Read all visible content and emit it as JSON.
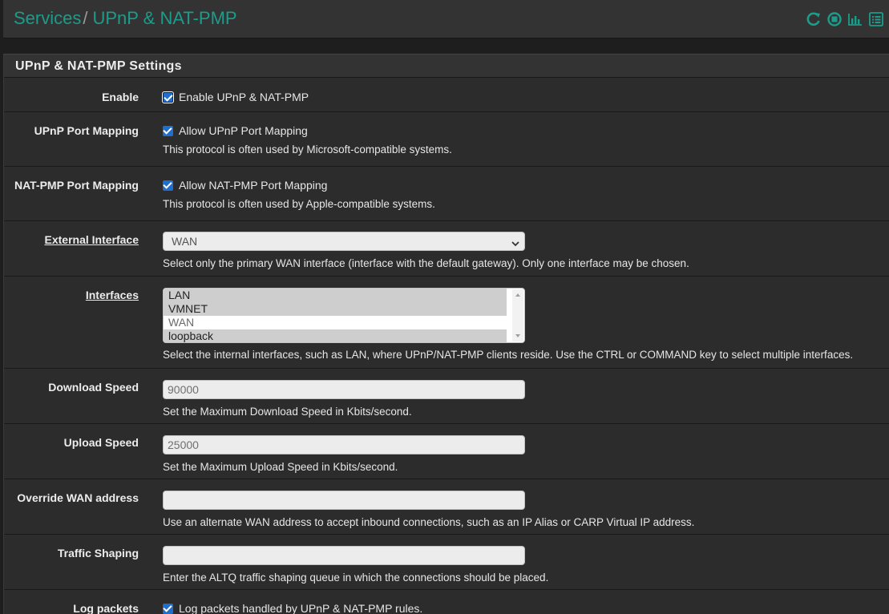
{
  "header": {
    "crumb_services": "Services",
    "separator": "/",
    "crumb_current": "UPnP & NAT-PMP",
    "icons": [
      "restart-service-icon",
      "stop-service-icon",
      "status-graph-icon",
      "log-list-icon"
    ]
  },
  "colors": {
    "accent": "#1c9c8b",
    "checkbox": "#1f6fd1",
    "panel_bg": "#2c2c2c",
    "page_bg": "#1e1e1e"
  },
  "panel": {
    "title": "UPnP & NAT-PMP Settings"
  },
  "enable": {
    "label": "Enable",
    "checkbox_text": "Enable UPnP & NAT-PMP",
    "checked": true
  },
  "upnp_port_mapping": {
    "label": "UPnP Port Mapping",
    "checkbox_text": "Allow UPnP Port Mapping",
    "checked": true,
    "help": "This protocol is often used by Microsoft-compatible systems."
  },
  "natpmp_port_mapping": {
    "label": "NAT-PMP Port Mapping",
    "checkbox_text": "Allow NAT-PMP Port Mapping",
    "checked": true,
    "help": "This protocol is often used by Apple-compatible systems."
  },
  "external_interface": {
    "label": "External Interface",
    "value": "WAN",
    "help": "Select only the primary WAN interface (interface with the default gateway). Only one interface may be chosen."
  },
  "interfaces": {
    "label": "Interfaces",
    "options": [
      {
        "text": "LAN",
        "selected": true
      },
      {
        "text": "VMNET",
        "selected": true
      },
      {
        "text": "WAN",
        "selected": false
      },
      {
        "text": "loopback",
        "selected": true
      }
    ],
    "help": "Select the internal interfaces, such as LAN, where UPnP/NAT-PMP clients reside. Use the CTRL or COMMAND key to select multiple interfaces."
  },
  "download_speed": {
    "label": "Download Speed",
    "value": "90000",
    "help": "Set the Maximum Download Speed in Kbits/second."
  },
  "upload_speed": {
    "label": "Upload Speed",
    "value": "25000",
    "help": "Set the Maximum Upload Speed in Kbits/second."
  },
  "override_wan": {
    "label": "Override WAN address",
    "value": "",
    "help": "Use an alternate WAN address to accept inbound connections, such as an IP Alias or CARP Virtual IP address."
  },
  "traffic_shaping": {
    "label": "Traffic Shaping",
    "value": "",
    "help": "Enter the ALTQ traffic shaping queue in which the connections should be placed."
  },
  "log_packets": {
    "label": "Log packets",
    "checkbox_text": "Log packets handled by UPnP & NAT-PMP rules.",
    "checked": true
  }
}
